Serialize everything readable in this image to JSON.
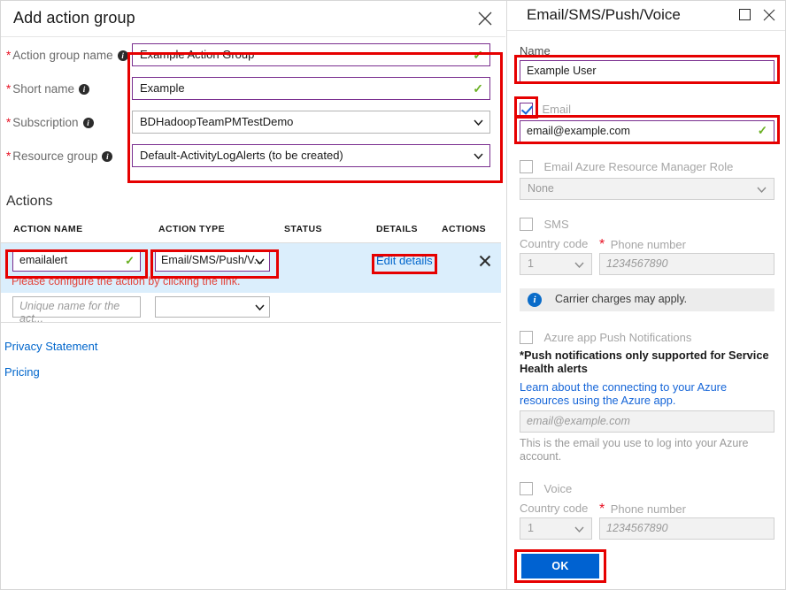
{
  "left_blade": {
    "title": "Add action group",
    "close_icon": "close-icon",
    "fields": [
      {
        "label": "Action group name",
        "required": true,
        "info_icon": "info-icon",
        "value": "Example Action Group",
        "control": "text",
        "valid": true,
        "border": "purple"
      },
      {
        "label": "Short name",
        "required": true,
        "info_icon": "info-icon",
        "value": "Example",
        "control": "text",
        "valid": true,
        "border": "purple"
      },
      {
        "label": "Subscription",
        "required": true,
        "info_icon": "info-icon",
        "value": "BDHadoopTeamPMTestDemo",
        "control": "select",
        "valid": false,
        "border": "gray"
      },
      {
        "label": "Resource group",
        "required": true,
        "info_icon": "info-icon",
        "value": "Default-ActivityLogAlerts (to be created)",
        "control": "select",
        "valid": false,
        "border": "purple"
      }
    ],
    "actions_heading": "Actions",
    "table": {
      "headers": [
        "ACTION NAME",
        "ACTION TYPE",
        "STATUS",
        "DETAILS",
        "ACTIONS"
      ],
      "row": {
        "action_name": "emailalert",
        "action_type": "Email/SMS/Push/V...",
        "status": "",
        "details_link": "Edit details",
        "remove_icon": "close-icon",
        "error": "Please configure the action by clicking the link."
      },
      "new_row": {
        "name_placeholder": "Unique name for the act...",
        "type_value": ""
      }
    },
    "links": {
      "privacy": "Privacy Statement",
      "pricing": "Pricing"
    }
  },
  "right_blade": {
    "title": "Email/SMS/Push/Voice",
    "maximize_icon": "maximize-icon",
    "close_icon": "close-icon",
    "name_label": "Name",
    "name_value": "Example User",
    "email": {
      "checkbox_label": "Email",
      "checked": true,
      "value": "email@example.com",
      "valid": true
    },
    "arm_role": {
      "checkbox_label": "Email Azure Resource Manager Role",
      "checked": false,
      "select_value": "None"
    },
    "sms": {
      "checkbox_label": "SMS",
      "checked": false,
      "country_code_label": "Country code",
      "country_code_value": "1",
      "phone_label": "Phone number",
      "phone_required": true,
      "phone_placeholder": "1234567890"
    },
    "carrier_notice": {
      "icon": "info-icon",
      "text": "Carrier charges may apply."
    },
    "push": {
      "checkbox_label": "Azure app Push Notifications",
      "checked": false,
      "note": "*Push notifications only supported for Service Health alerts",
      "link": "Learn about the connecting to your Azure resources using the Azure app.",
      "email_placeholder": "email@example.com",
      "helper": "This is the email you use to log into your Azure account."
    },
    "voice": {
      "checkbox_label": "Voice",
      "checked": false,
      "country_code_label": "Country code",
      "country_code_value": "1",
      "phone_label": "Phone number",
      "phone_required": true,
      "phone_placeholder": "1234567890"
    },
    "ok_button": "OK"
  },
  "colors": {
    "accent_purple": "#7a2f8f",
    "annotation_red": "#e60000",
    "link_blue": "#0066cc",
    "error_red": "#e2443b",
    "valid_green": "#6ab023",
    "row_highlight": "#dbeefc",
    "primary_button": "#0062d1"
  }
}
